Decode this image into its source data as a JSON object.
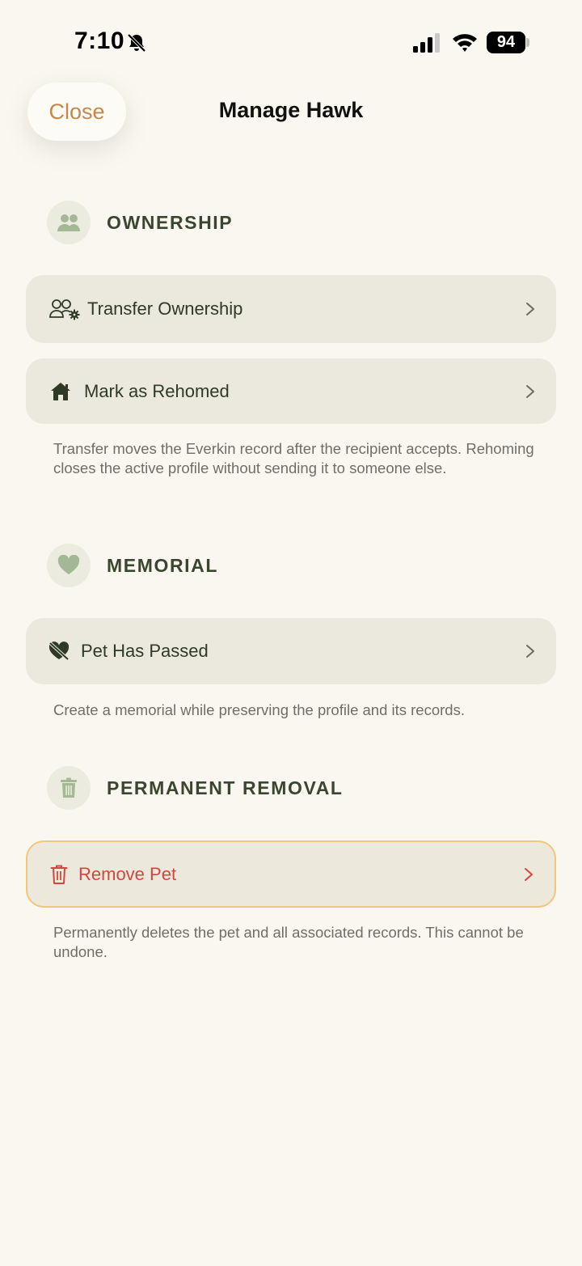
{
  "status_bar": {
    "time": "7:10",
    "battery": "94",
    "icons": [
      "bell-slash-icon",
      "signal-icon",
      "wifi-icon",
      "battery-icon"
    ]
  },
  "header": {
    "close_label": "Close",
    "title": "Manage Hawk"
  },
  "colors": {
    "background": "#f9f7ef",
    "row_background": "#ebe9dd",
    "accent": "#c8874a",
    "section_icon": "#a4b896",
    "danger_text": "#d4453f",
    "danger_border": "#efc77d"
  },
  "sections": {
    "ownership": {
      "title": "OWNERSHIP",
      "icon": "people-icon",
      "rows": [
        {
          "label": "Transfer Ownership",
          "icon": "people-gear-icon"
        },
        {
          "label": "Mark as Rehomed",
          "icon": "house-icon"
        }
      ],
      "footnote": "Transfer moves the Everkin record after the recipient accepts. Rehoming closes the active profile without sending it to someone else."
    },
    "memorial": {
      "title": "MEMORIAL",
      "icon": "heart-icon",
      "rows": [
        {
          "label": "Pet Has Passed",
          "icon": "heart-slash-icon"
        }
      ],
      "footnote": "Create a memorial while preserving the profile and its records."
    },
    "removal": {
      "title": "PERMANENT REMOVAL",
      "icon": "trash-icon",
      "rows": [
        {
          "label": "Remove Pet",
          "icon": "trash-icon"
        }
      ],
      "footnote": "Permanently deletes the pet and all associated records. This cannot be undone."
    }
  }
}
